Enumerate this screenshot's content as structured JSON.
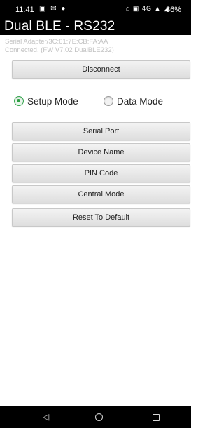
{
  "status_bar": {
    "time": "11:41",
    "notification_icons": "▣ ✉ ●",
    "system_icons": "⌂ ▣ 4G ▲ ◢",
    "battery": "86%"
  },
  "header": {
    "title": "Dual BLE - RS232"
  },
  "subtitle": {
    "line1": "Serial Adapter/3C:61:7E:CB:FA:AA",
    "line2": "Connected. (FW V7.02 DualBLE232)"
  },
  "buttons": {
    "disconnect": "Disconnect",
    "serial_port": "Serial Port",
    "device_name": "Device Name",
    "pin_code": "PIN Code",
    "central_mode": "Central Mode",
    "reset_default": "Reset To Default"
  },
  "mode": {
    "setup_label": "Setup Mode",
    "data_label": "Data Mode",
    "selected": "setup"
  },
  "nav": {
    "back_glyph": "◁"
  },
  "colors": {
    "radio_checked": "#2f9e44",
    "header_bg": "#000000"
  }
}
